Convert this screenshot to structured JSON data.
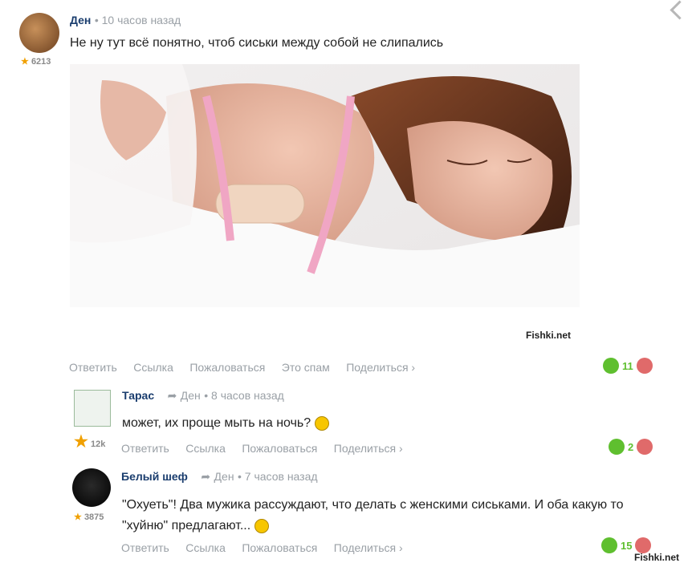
{
  "comments": [
    {
      "user": "Ден",
      "time": "10 часов назад",
      "karma": "6213",
      "text": "Не ну тут всё понятно, чтоб сиськи между собой не слипались",
      "watermark": "Fishki.net",
      "actions": [
        "Ответить",
        "Ссылка",
        "Пожаловаться",
        "Это спам",
        "Поделиться ›"
      ],
      "likes": "11"
    },
    {
      "user": "Тарас",
      "reply_to": "Ден",
      "time": "8 часов назад",
      "karma": "12k",
      "text": "может, их проще мыть на ночь?",
      "actions": [
        "Ответить",
        "Ссылка",
        "Пожаловаться",
        "Поделиться ›"
      ],
      "likes": "2"
    },
    {
      "user": "Белый шеф",
      "reply_to": "Ден",
      "time": "7 часов назад",
      "karma": "3875",
      "text": "\"Охуеть\"! Два мужика рассуждают, что делать с женскими сиськами. И оба какую то \"хуйню\" предлагают...",
      "actions": [
        "Ответить",
        "Ссылка",
        "Пожаловаться",
        "Поделиться ›"
      ],
      "likes": "15"
    }
  ],
  "footer_watermark": "Fishki.net",
  "colors": {
    "like": "#5fbf2f",
    "dislike": "#e06a6a",
    "username": "#1a3d6e",
    "meta": "#9aa0a6"
  }
}
